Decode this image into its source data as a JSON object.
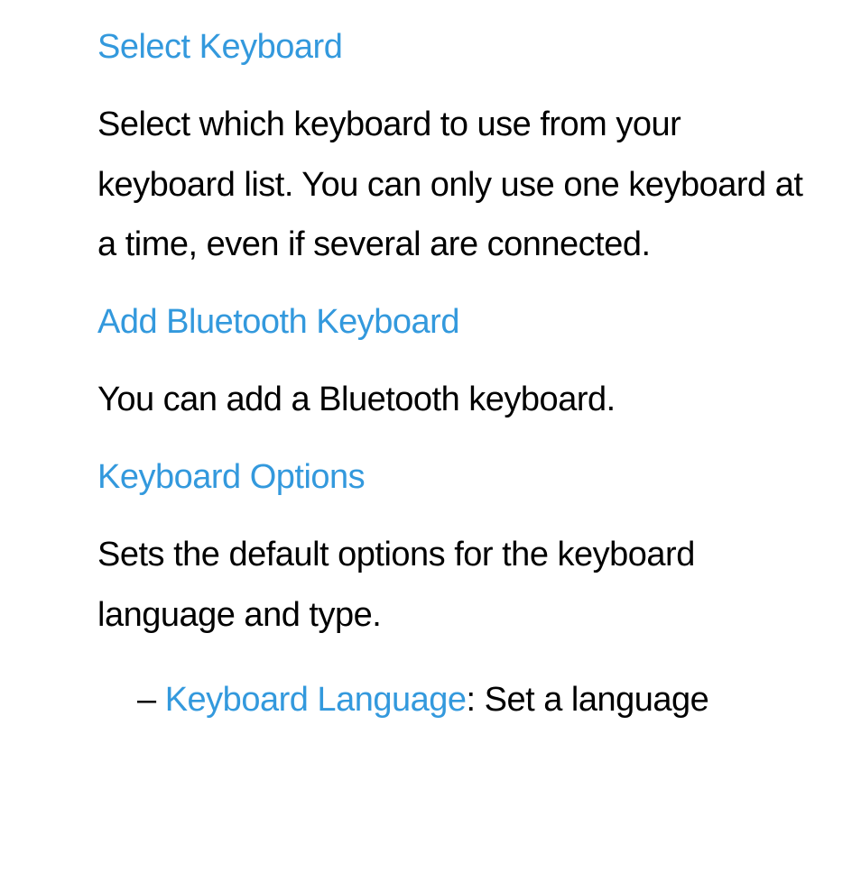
{
  "sections": [
    {
      "heading": "Select Keyboard",
      "body": "Select which keyboard to use from your keyboard list. You can only use one keyboard at a time, even if several are connected."
    },
    {
      "heading": "Add Bluetooth Keyboard",
      "body": "You can add a Bluetooth keyboard."
    },
    {
      "heading": "Keyboard Options",
      "body": "Sets the default options for the keyboard language and type."
    }
  ],
  "list_item": {
    "dash": "–",
    "label": "Keyboard Language",
    "rest": ": Set a language"
  }
}
